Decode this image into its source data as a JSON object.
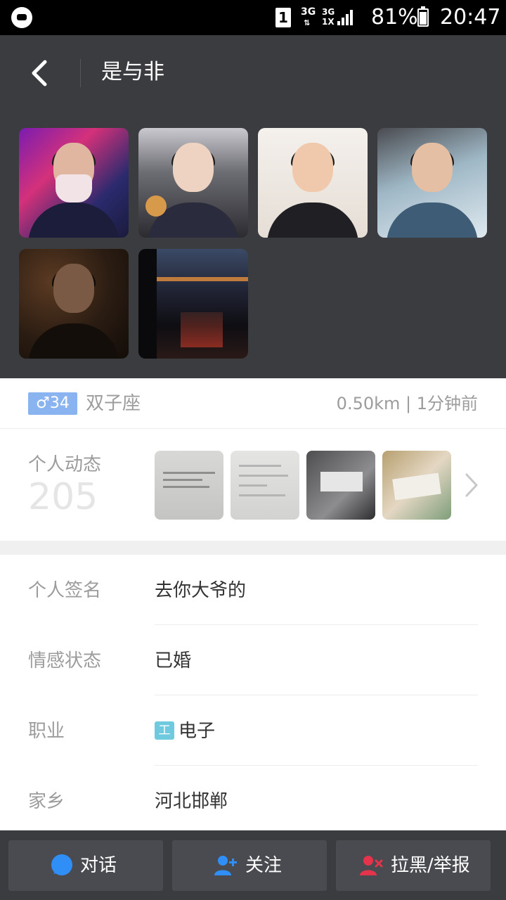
{
  "status_bar": {
    "sim_slot": "1",
    "network_1": "3G",
    "network_2_top": "3G",
    "network_2_bottom": "1X",
    "battery": "81%",
    "time": "20:47"
  },
  "header": {
    "title": "是与非"
  },
  "gallery": {
    "photo_count": 6
  },
  "profile": {
    "gender_symbol": "♂",
    "age": "34",
    "zodiac": "双子座",
    "distance_time": "0.50km | 1分钟前"
  },
  "moments": {
    "label": "个人动态",
    "count": "205"
  },
  "details": [
    {
      "label": "个人签名",
      "value": "去你大爷的"
    },
    {
      "label": "情感状态",
      "value": "已婚"
    },
    {
      "label": "职业",
      "tag": "工",
      "value": "电子"
    },
    {
      "label": "家乡",
      "value": "河北邯郸"
    }
  ],
  "actions": {
    "chat": "对话",
    "follow": "关注",
    "block_report": "拉黑/举报"
  },
  "colors": {
    "header_bg": "#3b3c40",
    "gender_badge": "#8ab4f0",
    "chat_icon": "#2f8ff7",
    "follow_icon": "#2f8ff7",
    "block_icon": "#e5334c",
    "job_tag": "#6fcadf"
  }
}
